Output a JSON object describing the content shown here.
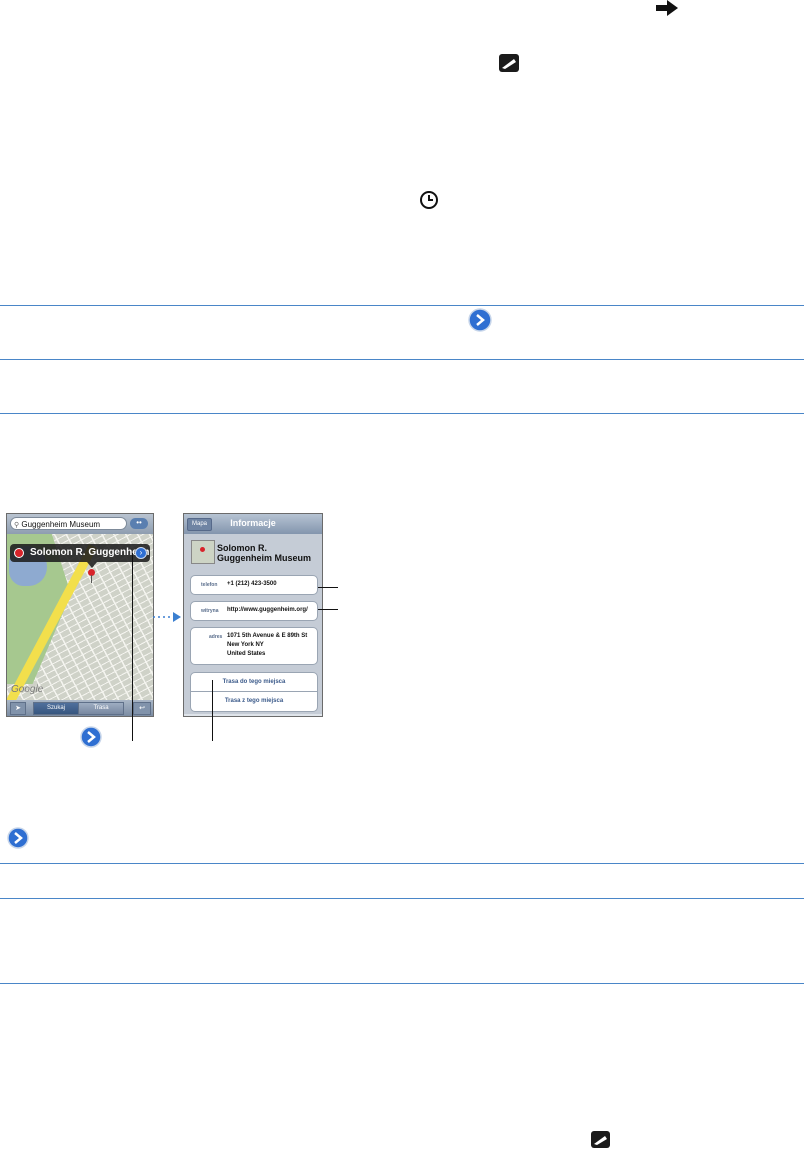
{
  "icons": {
    "arrow": "right-arrow-icon",
    "bookmark": "bookmark-icon",
    "clock": "clock-icon",
    "disclosure": "disclosure-button-icon"
  },
  "colors": {
    "rule": "#4a86c8",
    "disclosure": "#2f6fd2",
    "pin": "#d8232a",
    "avenue": "#f2df4c"
  },
  "map_screen": {
    "search_value": "Guggenheim Museum",
    "callout_title": "Solomon R. Guggenheim Museum",
    "watermark": "Google",
    "segments": [
      "Szukaj",
      "Trasa"
    ]
  },
  "info_screen": {
    "back_button": "Mapa",
    "title": "Informacje",
    "place_line1": "Solomon R.",
    "place_line2": "Guggenheim Museum",
    "phone_label": "telefon",
    "phone_value": "+1 (212) 423-3500",
    "web_label": "witryna",
    "web_value": "http://www.guggenheim.org/",
    "address_label": "adres",
    "address_line1": "1071 5th Avenue & E 89th St",
    "address_line2": "New York NY",
    "address_line3": "United States",
    "directions_to": "Trasa do tego miejsca",
    "directions_from": "Trasa z tego miejsca"
  }
}
